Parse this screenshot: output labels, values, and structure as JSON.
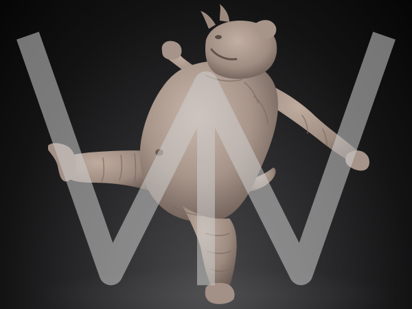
{
  "scene": {
    "subject": "clay-sculpt-horned-creature",
    "background_colors": [
      "#4a4a4c",
      "#2c2c2e",
      "#131314",
      "#050505"
    ],
    "material_color": "#a8958a",
    "material_shadow_color": "#6e5f57",
    "material_highlight_color": "#c8b5aa"
  },
  "watermark": {
    "icon": "w-logo-icon"
  }
}
